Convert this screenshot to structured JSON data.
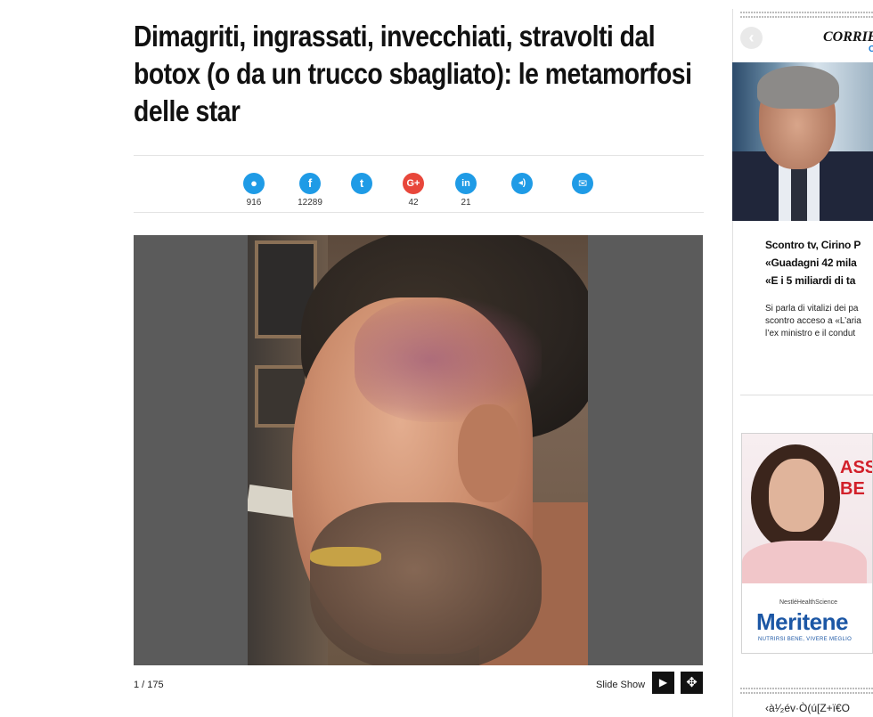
{
  "article": {
    "title": "Dimagriti, ingrassati, invecchiati, stravolti dal botox (o da un trucco sbagliato): le metamorfosi delle star",
    "share": [
      {
        "name": "comment",
        "icon": "comment-icon",
        "glyph": "●",
        "count": "916"
      },
      {
        "name": "facebook",
        "icon": "facebook-icon",
        "glyph": "f",
        "count": "12289"
      },
      {
        "name": "twitter",
        "icon": "twitter-icon",
        "glyph": "t",
        "count": ""
      },
      {
        "name": "google-plus",
        "icon": "google-plus-icon",
        "glyph": "G+",
        "count": "42"
      },
      {
        "name": "linkedin",
        "icon": "linkedin-icon",
        "glyph": "in",
        "count": "21"
      },
      {
        "name": "audio",
        "icon": "speaker-icon",
        "glyph": "◂)",
        "count": ""
      },
      {
        "name": "email",
        "icon": "mail-icon",
        "glyph": "✉",
        "count": ""
      }
    ],
    "gallery": {
      "counter": "1 / 175",
      "slideshow_label": "Slide Show",
      "play_icon": "play-icon",
      "fullscreen_icon": "fullscreen-icon"
    }
  },
  "sidebar": {
    "brand": "CORRIE",
    "brand_sub": "C",
    "prev_icon": "chevron-left-icon",
    "headline": "Scontro tv, Cirino P «Guadagni 42 mila «E i 5 miliardi di ta",
    "headline_lines": [
      "Scontro tv, Cirino P",
      "«Guadagni 42 mila",
      "«E i 5 miliardi di ta"
    ],
    "excerpt_lines": [
      "Si parla di vitalizi dei pa",
      "scontro acceso a «L’aria",
      "l’ex ministro e il condut"
    ],
    "ad": {
      "headline_lines": [
        "ASS",
        "BE"
      ],
      "maker": "NestléHealthScience",
      "brand": "Meritene",
      "tagline": "NUTRIRSI BENE, VIVERE MEGLIO"
    },
    "garbled_text": "‹à¹⁄₂év·Ò(ú[Z+ï€O"
  },
  "colors": {
    "share_blue": "#1f9be6",
    "gallery_bg": "#5b5b5b",
    "ad_red": "#d2202a",
    "ad_blue": "#1c57a5"
  }
}
